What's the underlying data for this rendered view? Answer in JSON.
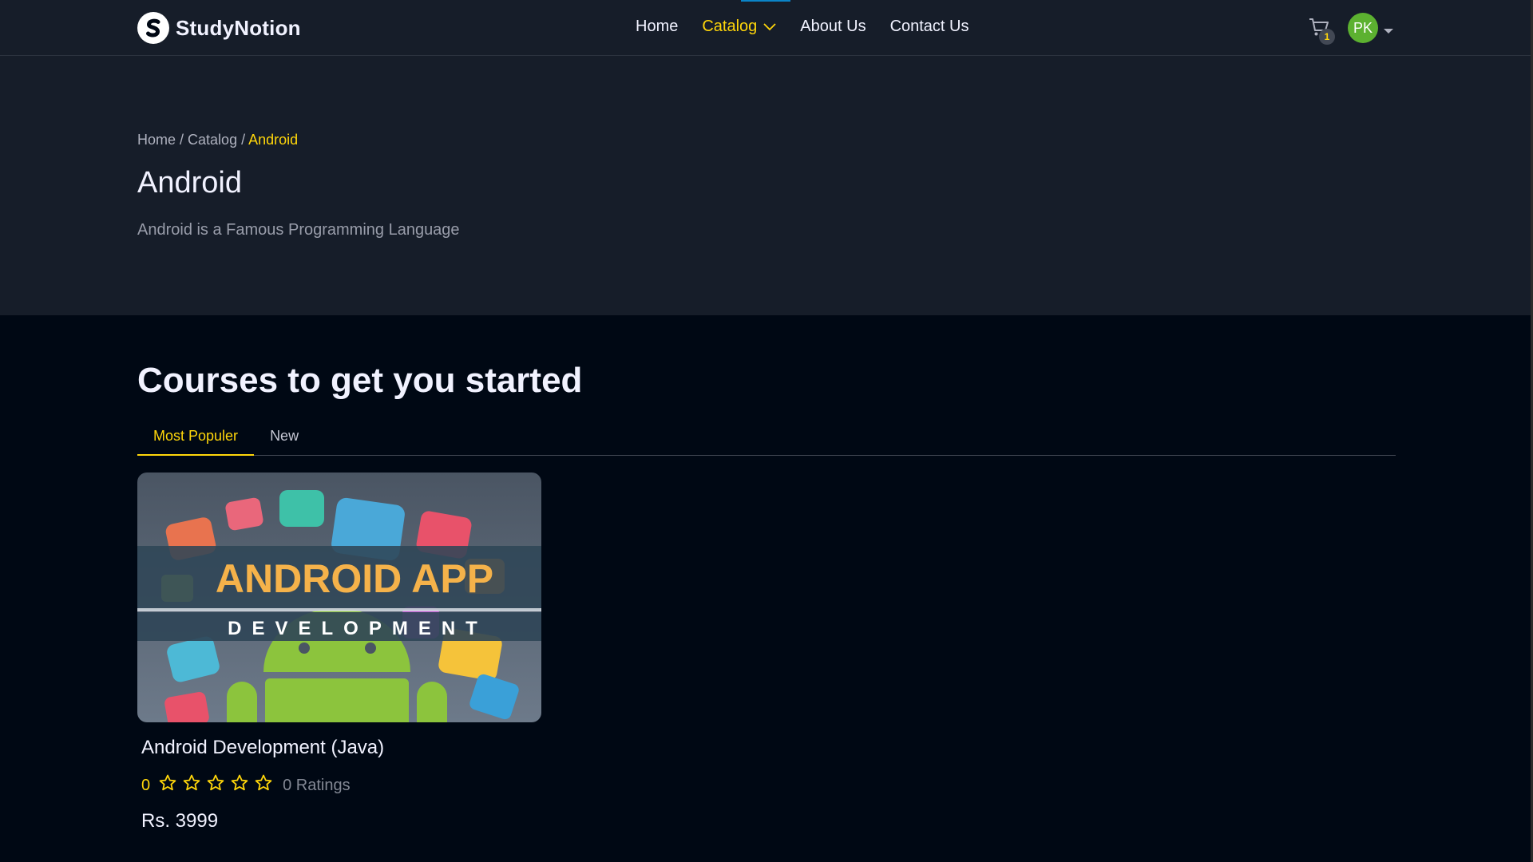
{
  "brand": {
    "name": "StudyNotion"
  },
  "nav": {
    "links": [
      {
        "label": "Home"
      },
      {
        "label": "Catalog"
      },
      {
        "label": "About Us"
      },
      {
        "label": "Contact Us"
      }
    ]
  },
  "cart": {
    "count": "1"
  },
  "user": {
    "initials": "PK"
  },
  "breadcrumb": {
    "home": "Home",
    "sep1": " / ",
    "catalog": "Catalog",
    "sep2": " / ",
    "current": "Android"
  },
  "category": {
    "title": "Android",
    "description": "Android is a Famous Programming Language"
  },
  "courses_section": {
    "heading": "Courses to get you started",
    "tabs": [
      {
        "label": "Most Populer",
        "active": true
      },
      {
        "label": "New",
        "active": false
      }
    ]
  },
  "course_card": {
    "thumbnail_line1": "ANDROID APP",
    "thumbnail_line2": "DEVELOPMENT",
    "title": "Android Development (Java)",
    "rating": "0",
    "stars_filled": 0,
    "stars_total": 5,
    "ratings_text": "0 Ratings",
    "price": "Rs. 3999"
  },
  "colors": {
    "accent": "#FFD60A",
    "navbar_bg": "#161D29",
    "page_bg": "#000814",
    "avatar_bg": "#5cb130"
  }
}
